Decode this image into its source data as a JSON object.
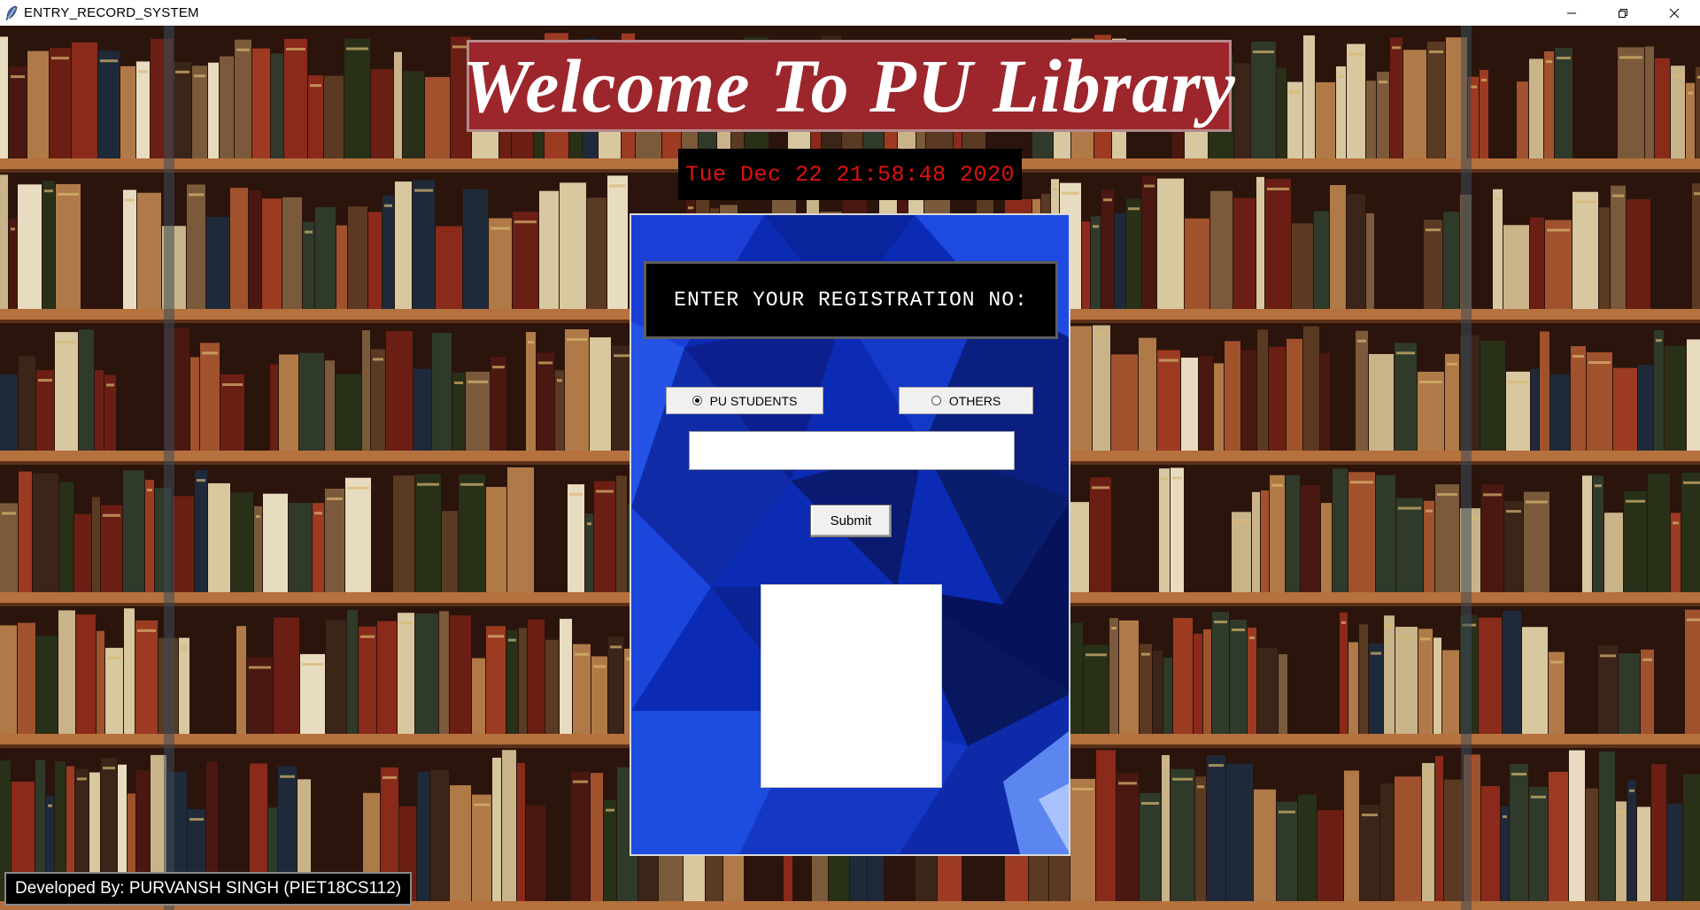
{
  "window": {
    "title": "ENTRY_RECORD_SYSTEM",
    "controls": [
      "minimize-icon",
      "restore-icon",
      "close-icon"
    ]
  },
  "header": {
    "title": "Welcome To PU Library",
    "clock": "Tue Dec 22 21:58:48 2020"
  },
  "form": {
    "prompt": "ENTER YOUR REGISTRATION NO:",
    "options": [
      {
        "label": "PU STUDENTS",
        "selected": true
      },
      {
        "label": "OTHERS",
        "selected": false
      }
    ],
    "registration_value": "",
    "submit_label": "Submit"
  },
  "footer": {
    "credit": "Developed By: PURVANSH SINGH (PIET18CS112)"
  },
  "colors": {
    "banner": "#9c262c",
    "clock_text": "#e01010",
    "panel": "#0b2bb8"
  }
}
